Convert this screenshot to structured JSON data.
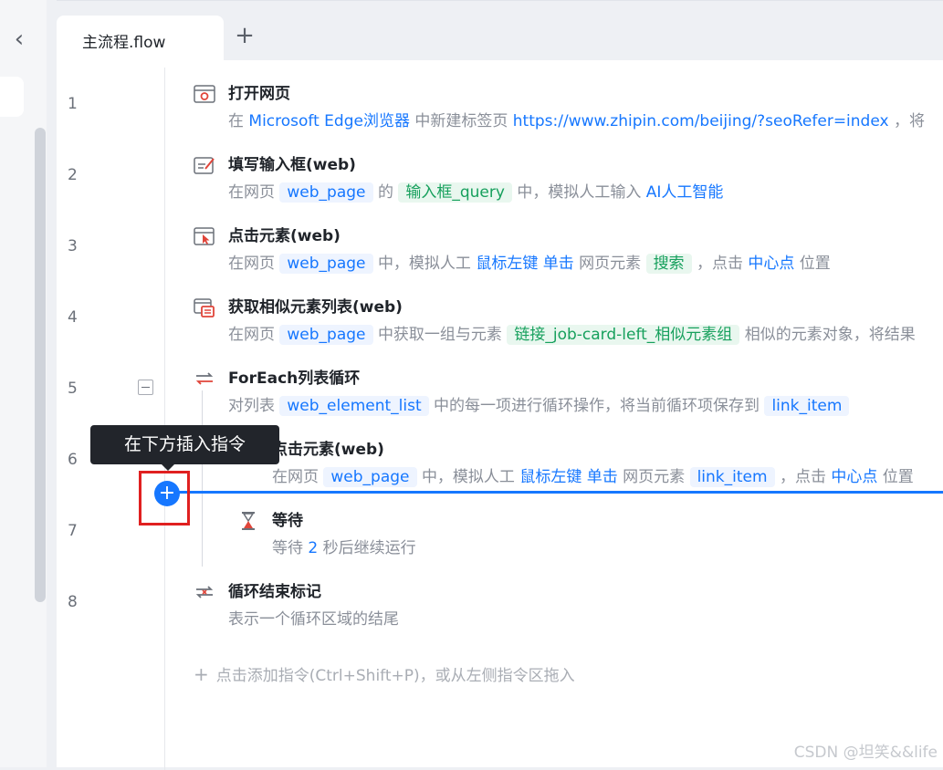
{
  "tab": {
    "title": "主流程.flow",
    "add_icon": "plus-icon"
  },
  "line_numbers": [
    "1",
    "2",
    "3",
    "4",
    "5",
    "6",
    "7",
    "8"
  ],
  "commands": {
    "c1": {
      "title": "打开网页",
      "icon": "open-webpage-icon",
      "d1": "在",
      "d2": "Microsoft Edge浏览器",
      "d3": "中新建标签页",
      "d4": "https://www.zhipin.com/beijing/?seoRefer=index",
      "d5": "，将"
    },
    "c2": {
      "title": "填写输入框(web)",
      "icon": "input-fill-icon",
      "d1": "在网页",
      "d2": "web_page",
      "d3": "的",
      "d4": "输入框_query",
      "d5": "中，模拟人工输入",
      "d6": "AI人工智能"
    },
    "c3": {
      "title": "点击元素(web)",
      "icon": "click-element-icon",
      "d1": "在网页",
      "d2": "web_page",
      "d3": "中，模拟人工",
      "d4": "鼠标左键 单击",
      "d5": "网页元素",
      "d6": "搜索",
      "d7": "，点击",
      "d8": "中心点",
      "d9": "位置"
    },
    "c4": {
      "title": "获取相似元素列表(web)",
      "icon": "similar-elements-icon",
      "d1": "在网页",
      "d2": "web_page",
      "d3": "中获取一组与元素",
      "d4": "链接_job-card-left_相似元素组",
      "d5": "相似的元素对象，将结果"
    },
    "c5": {
      "title": "ForEach列表循环",
      "icon": "loop-icon",
      "d1": "对列表",
      "d2": "web_element_list",
      "d3": "中的每一项进行循环操作，将当前循环项保存到",
      "d4": "link_item"
    },
    "c6": {
      "title": "点击元素(web)",
      "icon": "click-element-icon",
      "d1": "在网页",
      "d2": "web_page",
      "d3": "中，模拟人工",
      "d4": "鼠标左键 单击",
      "d5": "网页元素",
      "d6": "link_item",
      "d7": "，点击",
      "d8": "中心点",
      "d9": "位置"
    },
    "c7": {
      "title": "等待",
      "icon": "hourglass-icon",
      "d1": "等待",
      "d2": "2",
      "d3": "秒后继续运行"
    },
    "c8": {
      "title": "循环结束标记",
      "icon": "loop-end-icon",
      "d1": "表示一个循环区域的结尾"
    }
  },
  "tooltip": "在下方插入指令",
  "add_hint": "点击添加指令(Ctrl+Shift+P)，或从左侧指令区拖入",
  "watermark": "CSDN @坦笑&&life",
  "colors": {
    "accent": "#1677ff",
    "highlight_box": "#e02020",
    "tag_green": "#17a05d"
  }
}
